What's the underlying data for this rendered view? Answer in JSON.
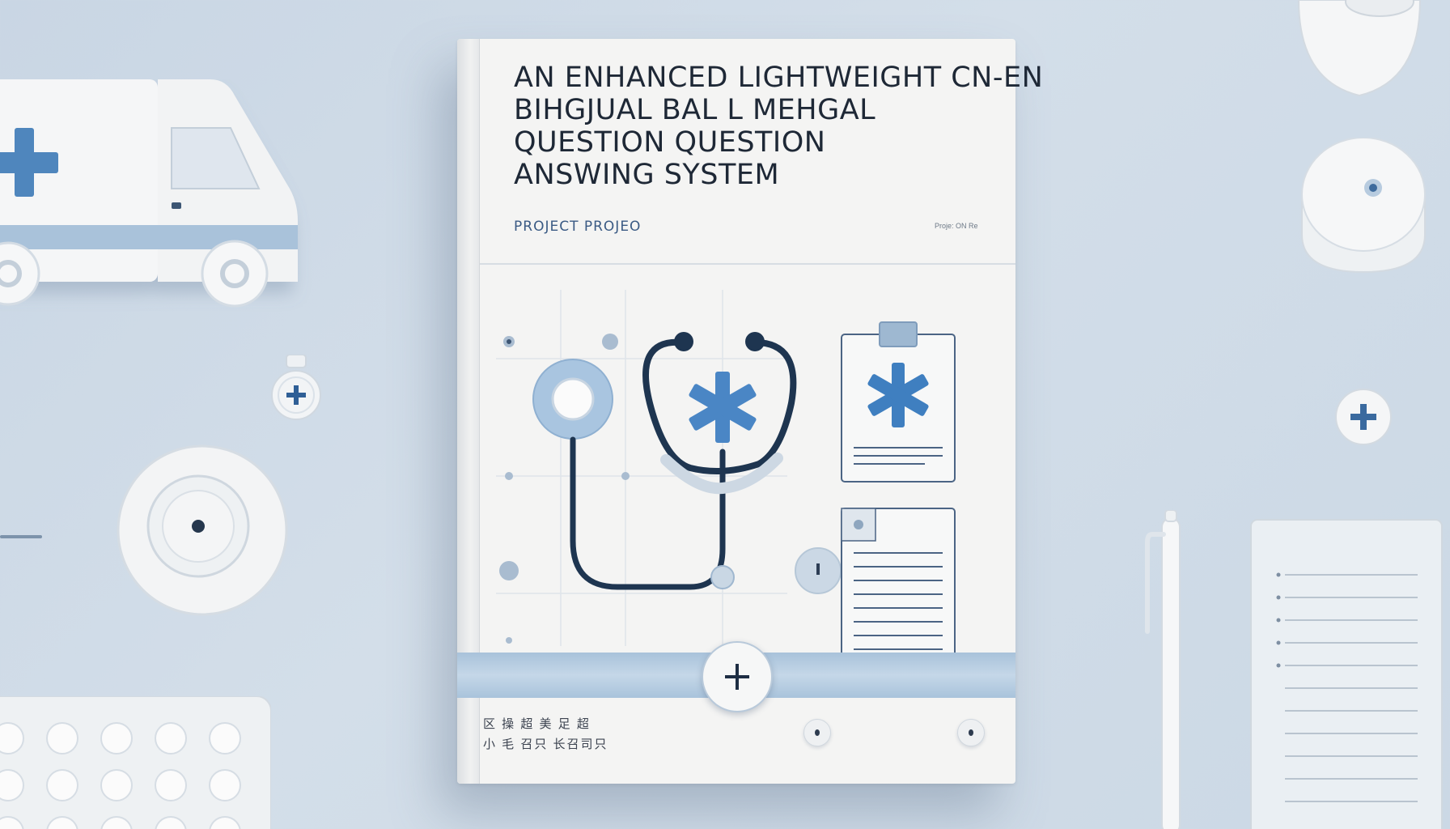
{
  "cover": {
    "title_lines": [
      "An Enhanced lightweight CN-EN",
      "Bihgjual bal L Mehgal",
      "Question Question",
      "Answing System"
    ],
    "project_label": "PROJECT PROJEO",
    "tiny_label": "Proje: ON Re",
    "footer_lines": [
      "区 操 超 美 足 超",
      "小 毛 召只 长召司只"
    ]
  },
  "colors": {
    "background": "#cbd8e5",
    "accent_blue": "#4a86c5",
    "navy": "#1e3550",
    "paper": "#f4f4f3"
  },
  "icons": [
    "ambulance-icon",
    "stethoscope-icon",
    "star-of-life-icon",
    "clipboard-icon",
    "document-icon",
    "plus-icon",
    "pill-tray-icon",
    "pen-icon",
    "notepad-icon"
  ]
}
